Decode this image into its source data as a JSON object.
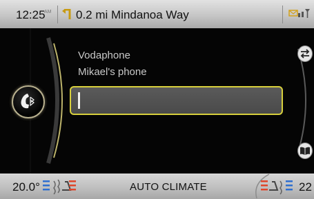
{
  "status_bar": {
    "time": "12:25",
    "ampm": "AM",
    "navigation_instruction": "0.2 mi Mindanoa Way",
    "turn_icon": "turn-left-arrow-icon",
    "status_icons": "message-and-signal-icon"
  },
  "phone": {
    "operator": "Vodaphone",
    "device_name": "Mikael's phone",
    "input_value": "",
    "phone_button_icon": "bluetooth-phone-icon",
    "side_top_icon": "swap-arrows-icon",
    "side_bottom_icon": "phonebook-icon"
  },
  "climate": {
    "left_temp": "20.0°",
    "right_temp": "22",
    "label": "AUTO CLIMATE",
    "left_seat_icon": "seat-heat-left-icon",
    "right_seat_icon": "seat-heat-right-icon"
  },
  "colors": {
    "accent": "#d8d03c",
    "heat": "#e0462a",
    "cool": "#2f6fd0"
  }
}
